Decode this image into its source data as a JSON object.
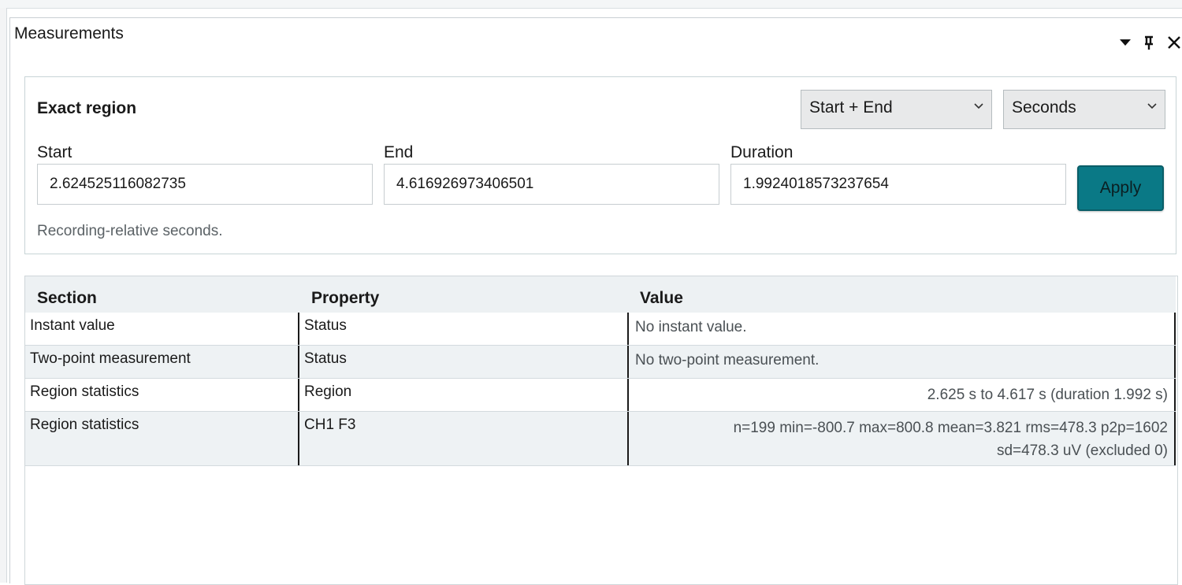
{
  "panel": {
    "title": "Measurements"
  },
  "region": {
    "title": "Exact region",
    "mode_select": "Start + End",
    "unit_select": "Seconds",
    "start_label": "Start",
    "start_value": "2.624525116082735",
    "end_label": "End",
    "end_value": "4.616926973406501",
    "duration_label": "Duration",
    "duration_value": "1.9924018573237654",
    "apply_label": "Apply",
    "hint": "Recording-relative seconds."
  },
  "table": {
    "headers": {
      "section": "Section",
      "property": "Property",
      "value": "Value"
    },
    "rows": [
      {
        "section": "Instant value",
        "property": "Status",
        "value": "No instant value."
      },
      {
        "section": "Two-point measurement",
        "property": "Status",
        "value": "No two-point measurement."
      },
      {
        "section": "Region statistics",
        "property": "Region",
        "value": "2.625 s to 4.617 s (duration 1.992 s)"
      },
      {
        "section": "Region statistics",
        "property": "CH1 F3",
        "value_line1": "n=199 min=-800.7 max=800.8 mean=3.821 rms=478.3 p2p=1602",
        "value_line2": "sd=478.3 uV (excluded 0)"
      }
    ]
  },
  "colors": {
    "accent": "#0a7986",
    "header_bg": "#edf1f3",
    "alt_row_bg": "#eef2f4"
  },
  "icons": [
    "dropdown-arrow-icon",
    "pin-icon",
    "close-icon",
    "chevron-down-icon"
  ]
}
